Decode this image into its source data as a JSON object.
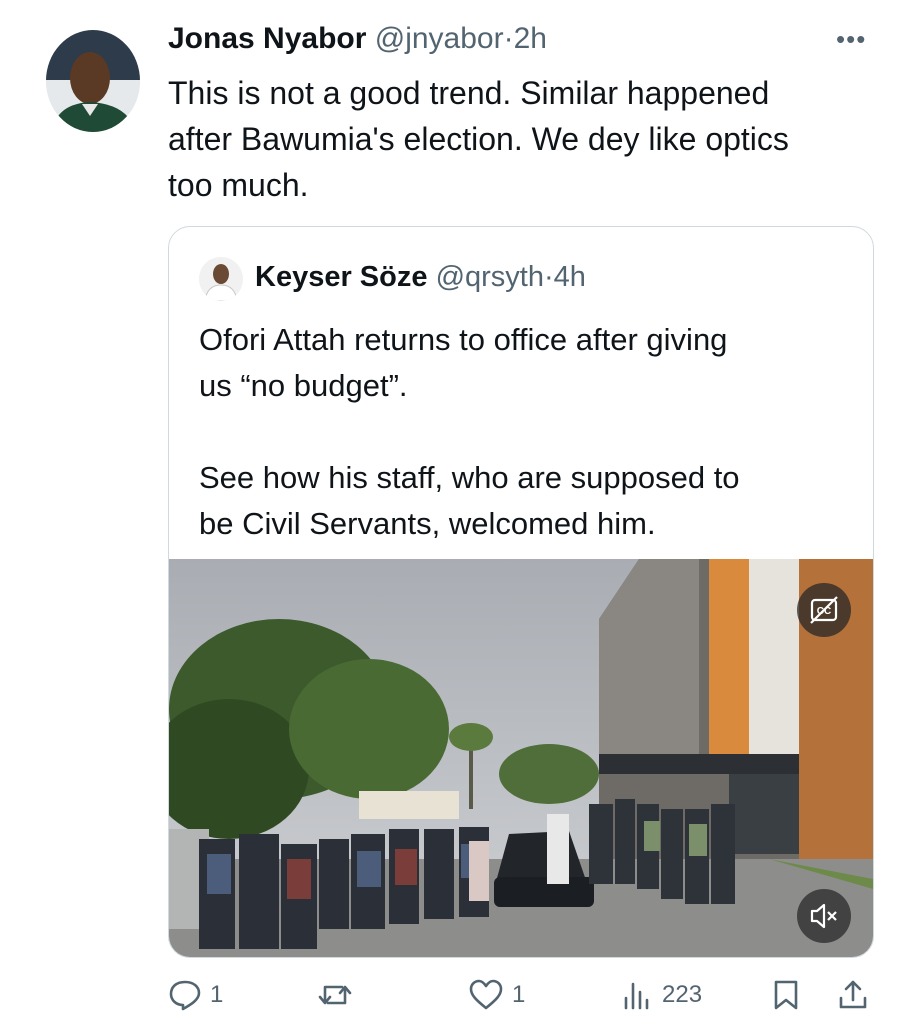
{
  "tweet": {
    "author_name": "Jonas Nyabor",
    "author_handle": "@jnyabor",
    "separator": "·",
    "time": "2h",
    "more_label": "•••",
    "text": "This is not a good trend. Similar happened\nafter Bawumia's election. We dey like optics\ntoo much."
  },
  "quoted": {
    "author_name": "Keyser Söze",
    "author_handle": "@qrsyth",
    "separator": "·",
    "time": "4h",
    "text": "Ofori Attah returns to office after giving\nus “no budget”.\n\nSee how his staff, who are supposed to\nbe Civil Servants, welcomed him.",
    "media": {
      "captions_icon": "closed-captions-icon",
      "mute_icon": "speaker-muted-icon"
    }
  },
  "actions": {
    "reply_count": "1",
    "retweet_count": "",
    "like_count": "1",
    "views_count": "223"
  },
  "colors": {
    "text": "#0f1419",
    "secondary": "#536471",
    "border": "#cfd9de"
  }
}
